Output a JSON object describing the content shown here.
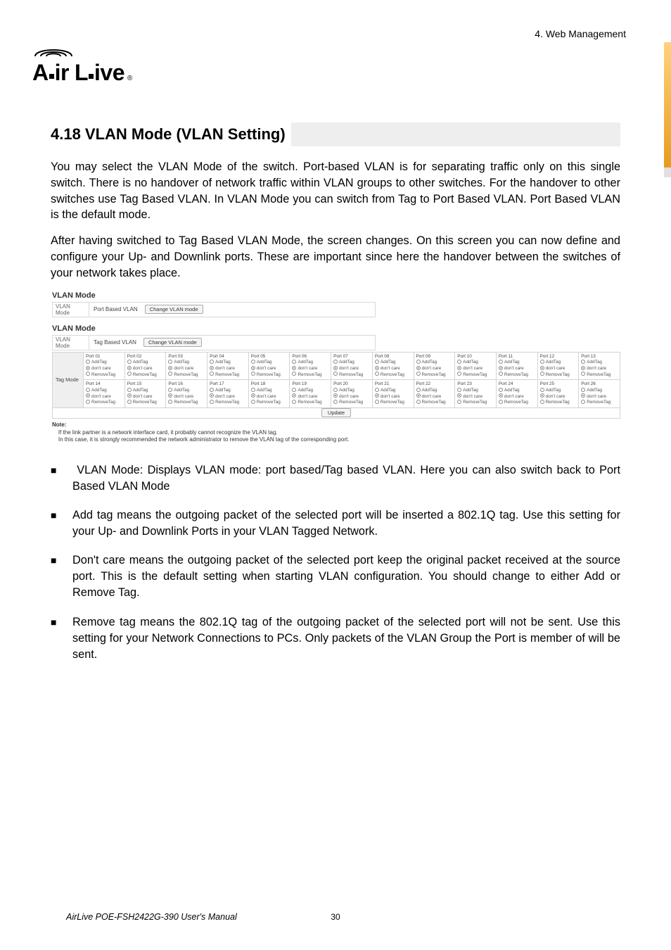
{
  "header": {
    "chapter": "4.  Web Management"
  },
  "logo": {
    "text_a": "A",
    "text_ir": "ir",
    "text_l": "L",
    "text_ive": "ive",
    "reg": "®"
  },
  "section": {
    "title": "4.18 VLAN Mode (VLAN Setting)"
  },
  "paragraphs": {
    "p1": "You may select the VLAN Mode of the switch. Port-based VLAN is for separating traffic only on this single switch. There is no handover of network traffic within VLAN groups to other switches. For the handover to other switches use Tag Based VLAN. In VLAN Mode you can switch from Tag to Port Based VLAN. Port Based VLAN is the default mode.",
    "p2": "After having switched to Tag Based VLAN Mode, the screen changes. On this screen you can now define and configure your Up- and Downlink ports. These are important since here the handover between the switches of your network takes place."
  },
  "screenshots": {
    "panel_title": "VLAN Mode",
    "mode_label": "VLAN\nMode",
    "mode1_value": "Port Based VLAN",
    "mode2_value": "Tag Based VLAN",
    "change_btn": "Change VLAN mode",
    "tag_mode_label": "Tag Mode",
    "radio_add": "AddTag",
    "radio_dont": "don't care",
    "radio_remove": "RemoveTag",
    "update_btn": "Update",
    "note_title": "Note:",
    "note_line1": "If the link partner is a network interface card, it probably cannot recognize the VLAN tag.",
    "note_line2": "In this case, it is strongly recommended the network administrator to remove the VLAN tag of the corresponding port.",
    "ports_row1": [
      "Port 01",
      "Port 02",
      "Port 03",
      "Port 04",
      "Port 05",
      "Port 06",
      "Port 07",
      "Port 08",
      "Port 09",
      "Port 10",
      "Port 11",
      "Port 12",
      "Port 13"
    ],
    "ports_row2": [
      "Port 14",
      "Port 15",
      "Port 16",
      "Port 17",
      "Port 18",
      "Port 19",
      "Port 20",
      "Port 21",
      "Port 22",
      "Port 23",
      "Port 24",
      "Port 25",
      "Port 26"
    ]
  },
  "bullets": {
    "b1": "VLAN Mode: Displays VLAN mode: port based/Tag based VLAN. Here you can also switch back to Port Based VLAN Mode",
    "b2": "Add tag means the outgoing packet of the selected port will be inserted a 802.1Q tag. Use this setting for your Up- and Downlink Ports in your VLAN Tagged Network.",
    "b3": "Don't care means the outgoing packet of the selected port keep the original packet received at the source port. This is the default setting when starting VLAN configuration. You should change to either Add or Remove Tag.",
    "b4": "Remove tag means the 802.1Q tag of the outgoing packet of the selected port will not be sent. Use this setting for your Network Connections to PCs. Only packets of the VLAN Group the Port is member of will be sent."
  },
  "footer": {
    "manual": "AirLive POE-FSH2422G-390 User's Manual",
    "page": "30"
  }
}
